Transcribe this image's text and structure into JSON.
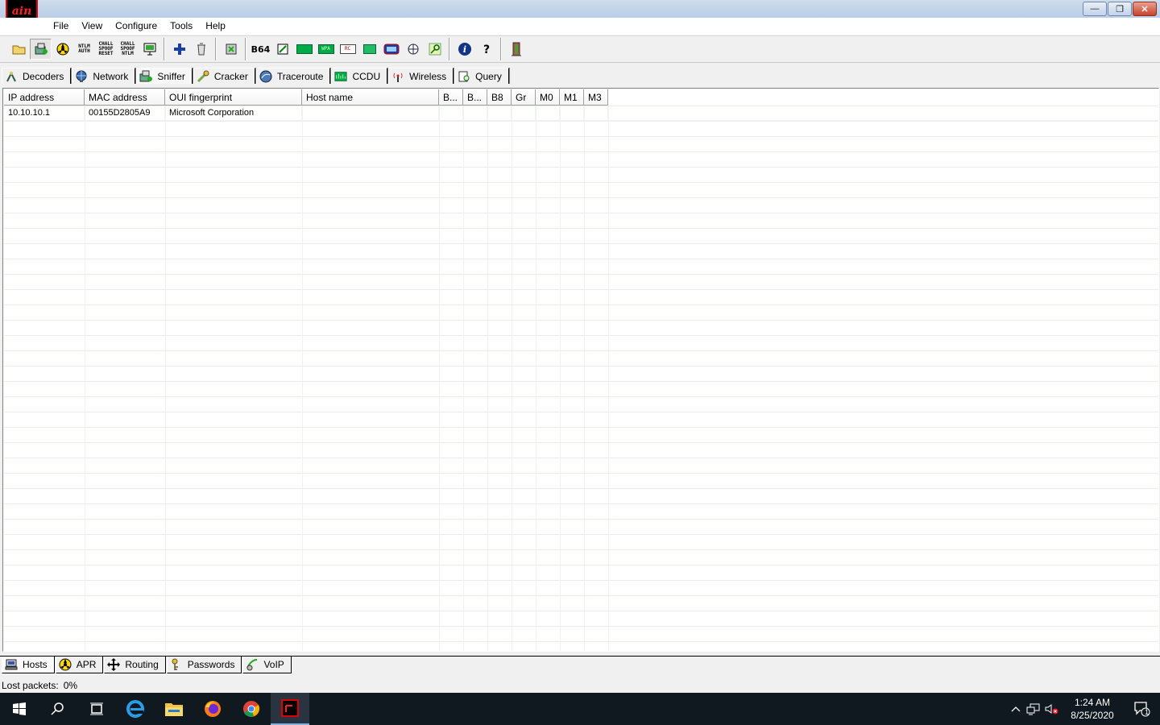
{
  "window": {
    "logo_text": "ain",
    "controls": {
      "minimize": "—",
      "restore": "❐",
      "close": "✕"
    }
  },
  "menubar": {
    "items": [
      "File",
      "View",
      "Configure",
      "Tools",
      "Help"
    ]
  },
  "toolbar": {
    "icons": [
      "open-folder-icon",
      "sniffer-toggle-icon",
      "apr-toggle-icon",
      "ntlm-auth-icon",
      "chall-spoof-reset-icon",
      "chall-spoof-ntlm-icon",
      "network-card-icon",
      "add-icon",
      "remove-icon",
      "delete-icon",
      "base64-icon",
      "hash-calculator-icon",
      "lcd-icon-1",
      "lcd-icon-2",
      "lcd-icon-3",
      "lcd-icon-4",
      "lcd-icon-5",
      "lcd-icon-6",
      "key-icon",
      "info-icon",
      "help-icon",
      "exit-icon"
    ],
    "lcd_labels": {
      "lcd1": "CCDU",
      "lcd2": "WPA",
      "lcd3": "RC"
    },
    "ntlm_label": "NTLM AUTH",
    "chall1_label": "CHALL SPOOF RESET",
    "chall2_label": "CHALL SPOOF NTLM",
    "b64_label": "B64"
  },
  "tabs_top": [
    {
      "label": "Decoders",
      "icon": "decoders-icon"
    },
    {
      "label": "Network",
      "icon": "network-icon"
    },
    {
      "label": "Sniffer",
      "icon": "sniffer-icon",
      "active": true
    },
    {
      "label": "Cracker",
      "icon": "cracker-icon"
    },
    {
      "label": "Traceroute",
      "icon": "traceroute-icon"
    },
    {
      "label": "CCDU",
      "icon": "ccdu-icon"
    },
    {
      "label": "Wireless",
      "icon": "wireless-icon"
    },
    {
      "label": "Query",
      "icon": "query-icon"
    }
  ],
  "table": {
    "columns": [
      "IP address",
      "MAC address",
      "OUI fingerprint",
      "Host name",
      "B...",
      "B...",
      "B8",
      "Gr",
      "M0",
      "M1",
      "M3"
    ],
    "rows": [
      [
        "10.10.10.1",
        "00155D2805A9",
        "Microsoft Corporation",
        "",
        "",
        "",
        "",
        "",
        "",
        "",
        ""
      ]
    ]
  },
  "tabs_bottom": [
    {
      "label": "Hosts",
      "icon": "hosts-icon",
      "active": true
    },
    {
      "label": "APR",
      "icon": "apr-icon"
    },
    {
      "label": "Routing",
      "icon": "routing-icon"
    },
    {
      "label": "Passwords",
      "icon": "passwords-icon"
    },
    {
      "label": "VoIP",
      "icon": "voip-icon"
    }
  ],
  "status": {
    "label": "Lost packets:",
    "value": "0%"
  },
  "taskbar": {
    "clock_time": "1:24 AM",
    "clock_date": "8/25/2020",
    "notification_count": "1"
  }
}
